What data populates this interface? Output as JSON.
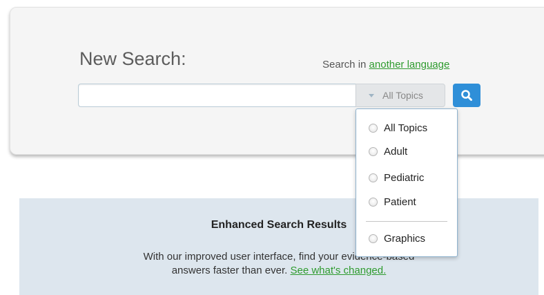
{
  "search": {
    "title": "New Search:",
    "lang_prefix": "Search in ",
    "lang_link": "another language",
    "input_value": "",
    "selected_topic": "All Topics",
    "button_color": "#2f8fd8"
  },
  "topics_dropdown": {
    "options": [
      {
        "label": "All Topics"
      },
      {
        "label": "Adult"
      },
      {
        "label": "Pediatric"
      },
      {
        "label": "Patient"
      },
      {
        "label": "Graphics"
      }
    ]
  },
  "info_panel": {
    "title": "Enhanced Search Results",
    "text_line1": "With our improved user interface, find your evidence-based",
    "text_line2": "answers faster than ever. ",
    "link": "See what's changed."
  },
  "colors": {
    "link_green": "#2e9b2e",
    "panel_bg": "#dde6ee",
    "card_bg": "#f5f5f5"
  },
  "icons": {
    "search_button": "magnifier-icon",
    "select_caret": "chevron-down-icon",
    "option_marker": "radio-icon"
  }
}
